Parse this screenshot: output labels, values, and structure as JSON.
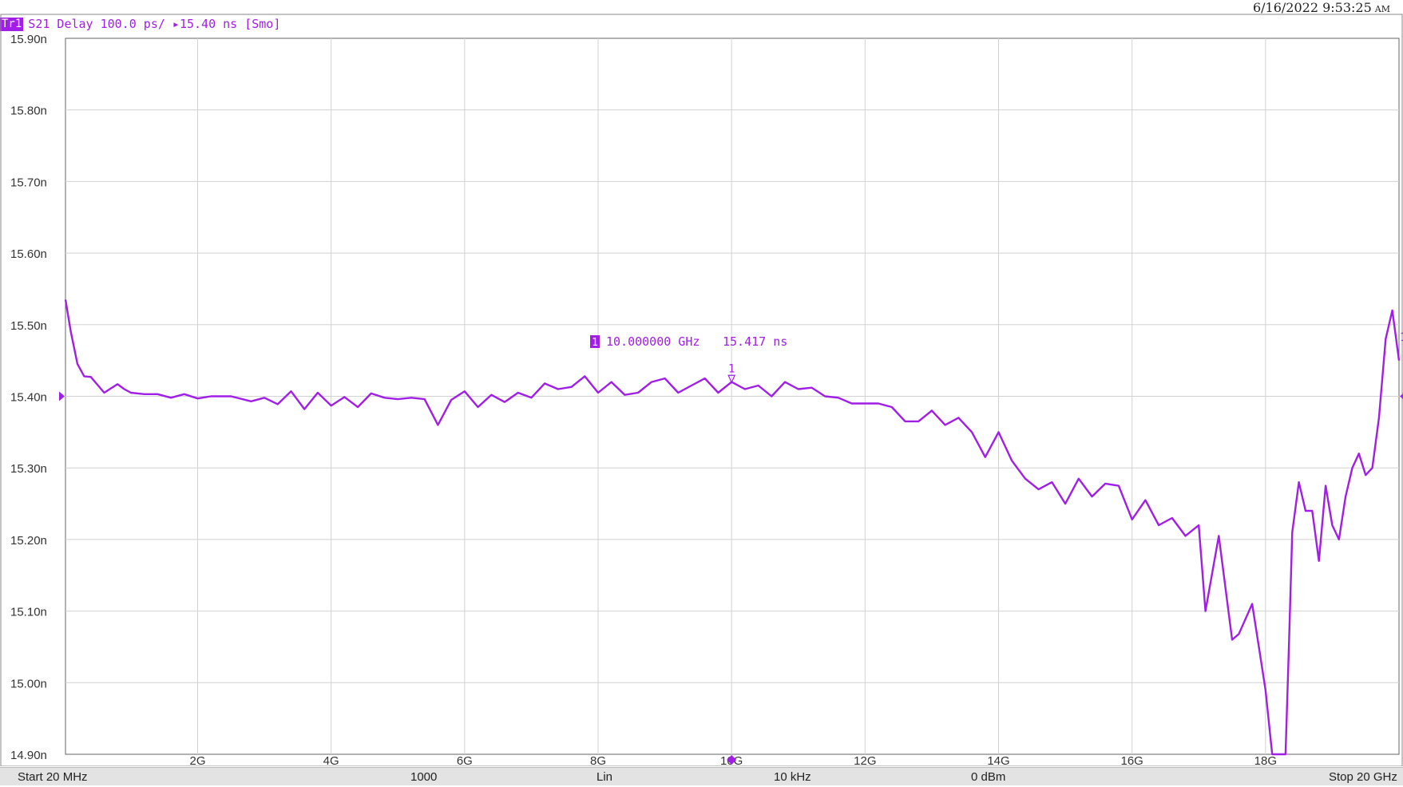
{
  "timestamp": {
    "date": "6/16/2022",
    "time": "9:53:25",
    "ampm": "AM"
  },
  "trace": {
    "tag": "Tr1",
    "header_text": "S21 Delay 100.0 ps/ ▸15.40 ns [Smo]",
    "color": "#a11ee6"
  },
  "marker": {
    "number": "1",
    "frequency_text": "10.000000 GHz",
    "value_text": "15.417 ns",
    "label": "1"
  },
  "right_marker_label": "1",
  "status_bar": {
    "start": "Start 20 MHz",
    "points": "1000",
    "sweep": "Lin",
    "ifbw": "10 kHz",
    "power": "0 dBm",
    "stop": "Stop 20 GHz"
  },
  "chart_data": {
    "type": "line",
    "title": "",
    "xlabel": "",
    "ylabel": "",
    "xlim": [
      0.02,
      20
    ],
    "ylim": [
      14.9,
      15.9
    ],
    "x_ticks": [
      2,
      4,
      6,
      8,
      10,
      12,
      14,
      16,
      18
    ],
    "x_tick_labels": [
      "2G",
      "4G",
      "6G",
      "8G",
      "10G",
      "12G",
      "14G",
      "16G",
      "18G"
    ],
    "y_ticks": [
      15.9,
      15.8,
      15.7,
      15.6,
      15.5,
      15.4,
      15.3,
      15.2,
      15.1,
      15.0,
      14.9
    ],
    "y_tick_labels": [
      "15.90n",
      "15.80n",
      "15.70n",
      "15.60n",
      "15.50n",
      "15.40n",
      "15.30n",
      "15.20n",
      "15.10n",
      "15.00n",
      "14.90n"
    ],
    "reference_level": 15.4,
    "grid": true,
    "series": [
      {
        "color": "#a11ee6",
        "x": [
          0.02,
          0.1,
          0.2,
          0.3,
          0.4,
          0.6,
          0.8,
          0.9,
          1.0,
          1.2,
          1.4,
          1.6,
          1.8,
          2.0,
          2.2,
          2.5,
          2.8,
          3.0,
          3.2,
          3.4,
          3.6,
          3.8,
          4.0,
          4.2,
          4.4,
          4.6,
          4.8,
          5.0,
          5.2,
          5.4,
          5.6,
          5.8,
          6.0,
          6.2,
          6.4,
          6.6,
          6.8,
          7.0,
          7.2,
          7.4,
          7.6,
          7.8,
          8.0,
          8.2,
          8.4,
          8.6,
          8.8,
          9.0,
          9.2,
          9.4,
          9.6,
          9.8,
          10.0,
          10.2,
          10.4,
          10.6,
          10.8,
          11.0,
          11.2,
          11.4,
          11.6,
          11.8,
          12.0,
          12.2,
          12.4,
          12.6,
          12.8,
          13.0,
          13.2,
          13.4,
          13.6,
          13.8,
          14.0,
          14.2,
          14.4,
          14.6,
          14.8,
          15.0,
          15.2,
          15.4,
          15.6,
          15.8,
          16.0,
          16.2,
          16.4,
          16.6,
          16.8,
          17.0,
          17.1,
          17.3,
          17.5,
          17.6,
          17.8,
          17.9,
          18.0,
          18.1,
          18.2,
          18.3,
          18.35,
          18.4,
          18.5,
          18.6,
          18.7,
          18.8,
          18.9,
          19.0,
          19.1,
          19.2,
          19.3,
          19.4,
          19.5,
          19.6,
          19.7,
          19.8,
          19.9,
          20.0
        ],
        "y": [
          15.535,
          15.49,
          15.445,
          15.428,
          15.427,
          15.405,
          15.417,
          15.41,
          15.405,
          15.403,
          15.403,
          15.398,
          15.403,
          15.397,
          15.4,
          15.4,
          15.393,
          15.398,
          15.389,
          15.407,
          15.382,
          15.405,
          15.387,
          15.399,
          15.385,
          15.404,
          15.398,
          15.396,
          15.398,
          15.396,
          15.36,
          15.395,
          15.407,
          15.385,
          15.402,
          15.392,
          15.405,
          15.398,
          15.418,
          15.41,
          15.413,
          15.428,
          15.405,
          15.42,
          15.402,
          15.405,
          15.42,
          15.425,
          15.405,
          15.415,
          15.425,
          15.405,
          15.42,
          15.41,
          15.415,
          15.4,
          15.42,
          15.41,
          15.412,
          15.4,
          15.398,
          15.39,
          15.39,
          15.39,
          15.385,
          15.365,
          15.365,
          15.38,
          15.36,
          15.37,
          15.35,
          15.315,
          15.35,
          15.31,
          15.285,
          15.27,
          15.28,
          15.25,
          15.285,
          15.26,
          15.278,
          15.275,
          15.228,
          15.255,
          15.22,
          15.23,
          15.205,
          15.22,
          15.1,
          15.205,
          15.06,
          15.068,
          15.11,
          15.05,
          14.99,
          14.9,
          14.9,
          14.9,
          15.05,
          15.21,
          15.28,
          15.24,
          15.24,
          15.17,
          15.275,
          15.22,
          15.2,
          15.26,
          15.3,
          15.32,
          15.29,
          15.3,
          15.37,
          15.48,
          15.52,
          15.45
        ]
      }
    ]
  }
}
